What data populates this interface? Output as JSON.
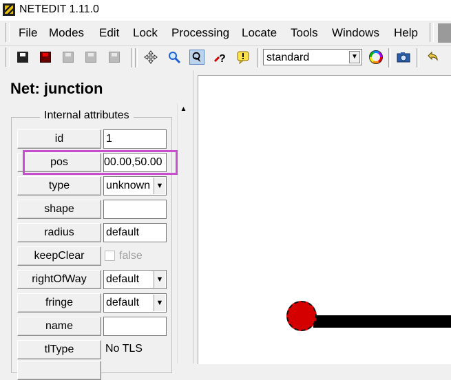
{
  "window": {
    "title": "NETEDIT 1.11.0",
    "icon": "netedit-logo-icon"
  },
  "menu": {
    "items": [
      {
        "label": "File"
      },
      {
        "label": "Modes"
      },
      {
        "label": "Edit"
      },
      {
        "label": "Lock"
      },
      {
        "label": "Processing"
      },
      {
        "label": "Locate"
      },
      {
        "label": "Tools"
      },
      {
        "label": "Windows"
      },
      {
        "label": "Help"
      }
    ]
  },
  "toolbar": {
    "icons": [
      "save-network-icon",
      "save-additionals-icon",
      "save-disabled-icon",
      "save-disabled-icon",
      "save-disabled-icon",
      "recenter-view-icon",
      "zoom-icon",
      "locate-icon",
      "help-icon",
      "warning-icon",
      "color-wheel-icon",
      "screenshot-icon",
      "undo-icon"
    ],
    "viewscheme": "standard"
  },
  "panel": {
    "title": "Net: junction",
    "group_title": "Internal attributes",
    "attributes": [
      {
        "name": "id",
        "value": "1"
      },
      {
        "name": "pos",
        "value": "00.00,50.00"
      },
      {
        "name": "type",
        "value": "unknown"
      },
      {
        "name": "shape",
        "value": ""
      },
      {
        "name": "radius",
        "value": "default"
      },
      {
        "name": "keepClear",
        "value": "false"
      },
      {
        "name": "rightOfWay",
        "value": "default"
      },
      {
        "name": "fringe",
        "value": "default"
      },
      {
        "name": "name",
        "value": ""
      },
      {
        "name": "tlType",
        "value": "No TLS"
      }
    ]
  },
  "colors": {
    "highlight": "#c84ed0",
    "junction": "#d40000",
    "edge": "#000000"
  }
}
